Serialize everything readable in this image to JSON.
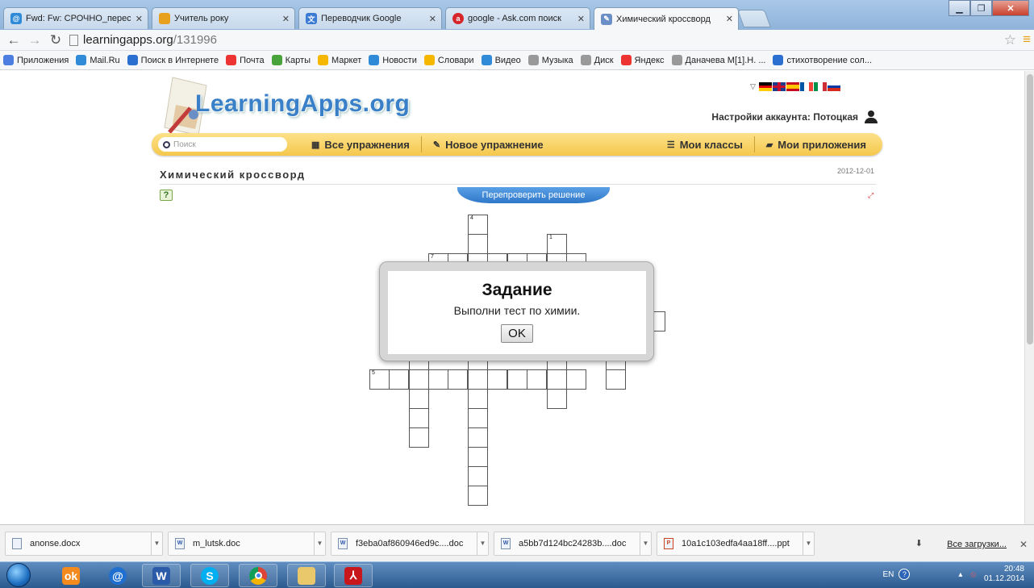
{
  "browser": {
    "tabs": [
      {
        "label": "Fwd: Fw: СРОЧНО_перес",
        "icon": "mail-ru-icon",
        "color": "#2f8ad8",
        "active": false
      },
      {
        "label": "Учитель року",
        "icon": "page-icon",
        "color": "#e7a11e",
        "active": false
      },
      {
        "label": "Переводчик Google",
        "icon": "google-translate-icon",
        "color": "#3b7bd4",
        "active": false
      },
      {
        "label": "google - Ask.com поиск",
        "icon": "ask-icon",
        "color": "#d6262b",
        "active": false
      },
      {
        "label": "Химический кроссворд",
        "icon": "learningapps-icon",
        "color": "#6a8fc7",
        "active": true
      }
    ],
    "address_host": "learningapps.org",
    "address_path": "/131996",
    "bookmarks": [
      {
        "label": "Приложения",
        "icon": "apps-icon",
        "color": "#4c7de0"
      },
      {
        "label": "Mail.Ru",
        "icon": "mail-ru-icon",
        "color": "#2f8ad8"
      },
      {
        "label": "Поиск в Интернете",
        "icon": "search-icon",
        "color": "#2b6fd0"
      },
      {
        "label": "Почта",
        "icon": "yandex-icon",
        "color": "#e33"
      },
      {
        "label": "Карты",
        "icon": "map-icon",
        "color": "#49a33b"
      },
      {
        "label": "Маркет",
        "icon": "market-icon",
        "color": "#f5b700"
      },
      {
        "label": "Новости",
        "icon": "mail-ru-icon",
        "color": "#2f8ad8"
      },
      {
        "label": "Словари",
        "icon": "dictionary-icon",
        "color": "#f5b700"
      },
      {
        "label": "Видео",
        "icon": "mail-ru-icon",
        "color": "#2f8ad8"
      },
      {
        "label": "Музыка",
        "icon": "page-icon",
        "color": "#999"
      },
      {
        "label": "Диск",
        "icon": "page-icon",
        "color": "#999"
      },
      {
        "label": "Яндекс",
        "icon": "yandex-icon",
        "color": "#e33"
      },
      {
        "label": "Даначева М[1].Н. ...",
        "icon": "page-icon",
        "color": "#999"
      },
      {
        "label": "стихотворение сол...",
        "icon": "search-icon",
        "color": "#2b6fd0"
      }
    ]
  },
  "site": {
    "logo": "LearningApps.org",
    "account_label": "Настройки аккаунта: Потоцкая",
    "search_placeholder": "Поиск",
    "menu": {
      "all_exercises": "Все упражнения",
      "new_exercise": "Новое упражнение",
      "my_classes": "Мои классы",
      "my_apps": "Мои приложения"
    },
    "flags": [
      "de",
      "gb",
      "es",
      "fr",
      "it",
      "ru"
    ]
  },
  "exercise": {
    "title": "Химический кроссворд",
    "date": "2012-12-01",
    "recheck_label": "Перепроверить решение"
  },
  "crossword": {
    "numbers": [
      "4",
      "1",
      "7",
      "5"
    ]
  },
  "dialog": {
    "title": "Задание",
    "text": "Выполни тест по химии.",
    "ok": "OK"
  },
  "downloads": {
    "items": [
      {
        "name": "anonse.docx",
        "type": "doc"
      },
      {
        "name": "m_lutsk.doc",
        "type": "word"
      },
      {
        "name": "f3eba0af860946ed9c....doc",
        "type": "word"
      },
      {
        "name": "a5bb7d124bc24283b....doc",
        "type": "word"
      },
      {
        "name": "10a1c103edfa4aa18ff....ppt",
        "type": "ppt"
      }
    ],
    "all_label": "Все загрузки..."
  },
  "taskbar": {
    "lang": "EN",
    "time": "20:48",
    "date": "01.12.2014"
  }
}
